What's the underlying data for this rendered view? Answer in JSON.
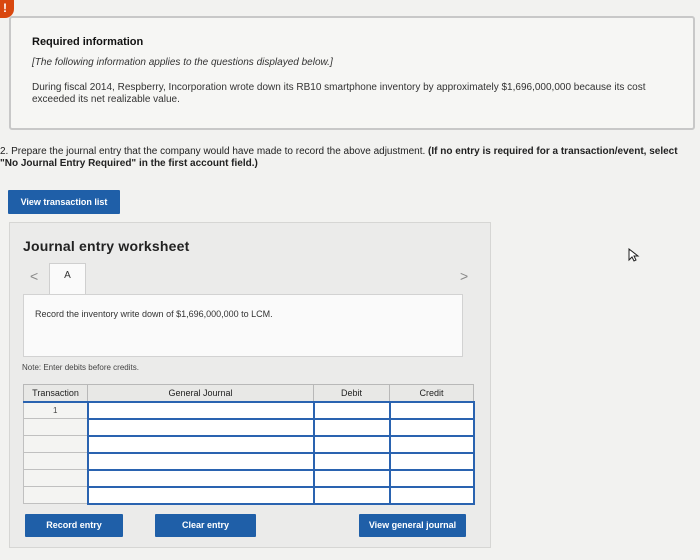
{
  "alert": {
    "glyph": "!"
  },
  "info": {
    "heading": "Required information",
    "applies": "[The following information applies to the questions displayed below.]",
    "body": "During fiscal 2014, Respberry, Incorporation wrote down its RB10 smartphone inventory by approximately $1,696,000,000 because its cost exceeded its net realizable value."
  },
  "question": {
    "number": "2.",
    "text": "Prepare the journal entry that the company would have made to record the above adjustment.",
    "instruction": "(If no entry is required for a transaction/event, select \"No Journal Entry Required\" in the first account field.)"
  },
  "buttons": {
    "view_transaction_list": "View transaction list",
    "record_entry": "Record entry",
    "clear_entry": "Clear entry",
    "view_general_journal": "View general journal"
  },
  "worksheet": {
    "title": "Journal entry worksheet",
    "tab": "A",
    "prev": "<",
    "next": ">",
    "record_text": "Record the inventory write down of $1,696,000,000 to LCM.",
    "note": "Note: Enter debits before credits."
  },
  "journal": {
    "headers": {
      "transaction": "Transaction",
      "general_journal": "General Journal",
      "debit": "Debit",
      "credit": "Credit"
    },
    "rows": [
      {
        "transaction": "1"
      },
      {
        "transaction": ""
      },
      {
        "transaction": ""
      },
      {
        "transaction": ""
      },
      {
        "transaction": ""
      },
      {
        "transaction": ""
      }
    ]
  }
}
